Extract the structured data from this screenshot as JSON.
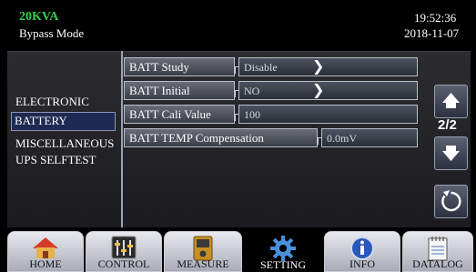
{
  "header": {
    "model": "20KVA",
    "mode": "Bypass Mode",
    "time": "19:52:36",
    "date": "2018-11-07"
  },
  "sidebar": {
    "items": [
      {
        "label": "ELECTRONIC"
      },
      {
        "label": "BATTERY"
      },
      {
        "label": "MISCELLANEOUS"
      },
      {
        "label": "UPS SELFTEST"
      }
    ]
  },
  "settings": {
    "rows": [
      {
        "label": "BATT Study",
        "value": "Disable"
      },
      {
        "label": "BATT Initial",
        "value": "NO"
      },
      {
        "label": "BATT Cali Value",
        "value": "100"
      },
      {
        "label": "BATT TEMP Compensation",
        "value": "0.0mV"
      }
    ]
  },
  "pager": {
    "indicator": "2/2"
  },
  "nav": {
    "tabs": [
      {
        "label": "HOME"
      },
      {
        "label": "CONTROL"
      },
      {
        "label": "MEASURE"
      },
      {
        "label": "SETTING"
      },
      {
        "label": "INFO"
      },
      {
        "label": "DATALOG"
      }
    ]
  },
  "colors": {
    "model_text": "#2fd24a",
    "active_side_bg": "#1e2a52"
  },
  "icons": {
    "home": "home-icon",
    "control": "sliders-icon",
    "measure": "meter-icon",
    "setting": "gear-icon",
    "info": "info-icon",
    "datalog": "notebook-icon"
  }
}
